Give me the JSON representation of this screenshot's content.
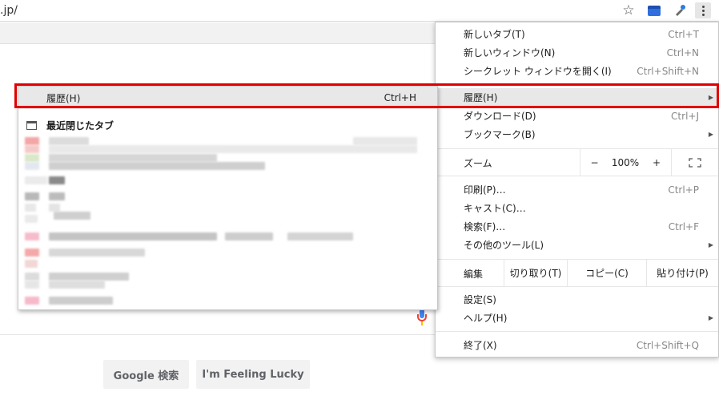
{
  "address_bar": {
    "url": ".jp/"
  },
  "google": {
    "search_button": "Google 検索",
    "lucky_button": "I'm Feeling Lucky"
  },
  "menu": {
    "new_tab": {
      "label": "新しいタブ(T)",
      "shortcut": "Ctrl+T"
    },
    "new_window": {
      "label": "新しいウィンドウ(N)",
      "shortcut": "Ctrl+N"
    },
    "incognito": {
      "label": "シークレット ウィンドウを開く(I)",
      "shortcut": "Ctrl+Shift+N"
    },
    "history": {
      "label": "履歴(H)"
    },
    "downloads": {
      "label": "ダウンロード(D)",
      "shortcut": "Ctrl+J"
    },
    "bookmarks": {
      "label": "ブックマーク(B)"
    },
    "zoom": {
      "label": "ズーム",
      "minus": "−",
      "level": "100%",
      "plus": "+"
    },
    "print": {
      "label": "印刷(P)…",
      "shortcut": "Ctrl+P"
    },
    "cast": {
      "label": "キャスト(C)…"
    },
    "find": {
      "label": "検索(F)…",
      "shortcut": "Ctrl+F"
    },
    "more_tools": {
      "label": "その他のツール(L)"
    },
    "edit": {
      "label": "編集",
      "cut": "切り取り(T)",
      "copy": "コピー(C)",
      "paste": "貼り付け(P)"
    },
    "settings": {
      "label": "設定(S)"
    },
    "help": {
      "label": "ヘルプ(H)"
    },
    "exit": {
      "label": "終了(X)",
      "shortcut": "Ctrl+Shift+Q"
    }
  },
  "history_submenu": {
    "history": {
      "label": "履歴(H)",
      "shortcut": "Ctrl+H"
    },
    "recently_closed": "最近閉じたタブ"
  },
  "colors": {
    "highlight_border": "#e00000",
    "menu_hover": "#e8e8e8"
  }
}
